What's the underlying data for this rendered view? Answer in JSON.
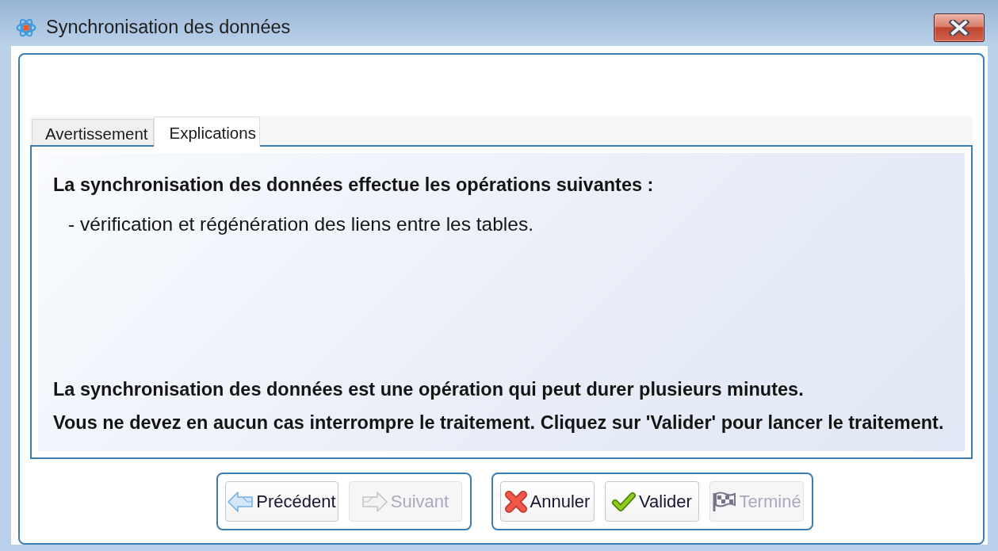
{
  "window": {
    "title": "Synchronisation des données"
  },
  "tabs": [
    {
      "label": "Avertissement",
      "selected": false
    },
    {
      "label": "Explications",
      "selected": true
    }
  ],
  "panel": {
    "intro": [
      {
        "kind": "heading",
        "text": "La synchronisation des données effectue les opérations suivantes :"
      },
      {
        "kind": "item",
        "text": "- vérification et régénération des liens entre les tables."
      }
    ],
    "notes": [
      "La synchronisation des données est une opération qui peut durer plusieurs minutes.",
      "Vous ne devez en aucun cas interrompre le traitement. Cliquez sur 'Valider' pour lancer le traitement."
    ]
  },
  "button_groups": [
    [
      {
        "label": "Précédent",
        "kind": "back",
        "disabled": false
      },
      {
        "label": "Suivant",
        "kind": "next",
        "disabled": true
      }
    ],
    [
      {
        "label": "Annuler",
        "kind": "cancel",
        "disabled": false
      },
      {
        "label": "Valider",
        "kind": "confirm",
        "disabled": false
      },
      {
        "label": "Terminé",
        "kind": "finish",
        "disabled": true
      }
    ]
  ]
}
